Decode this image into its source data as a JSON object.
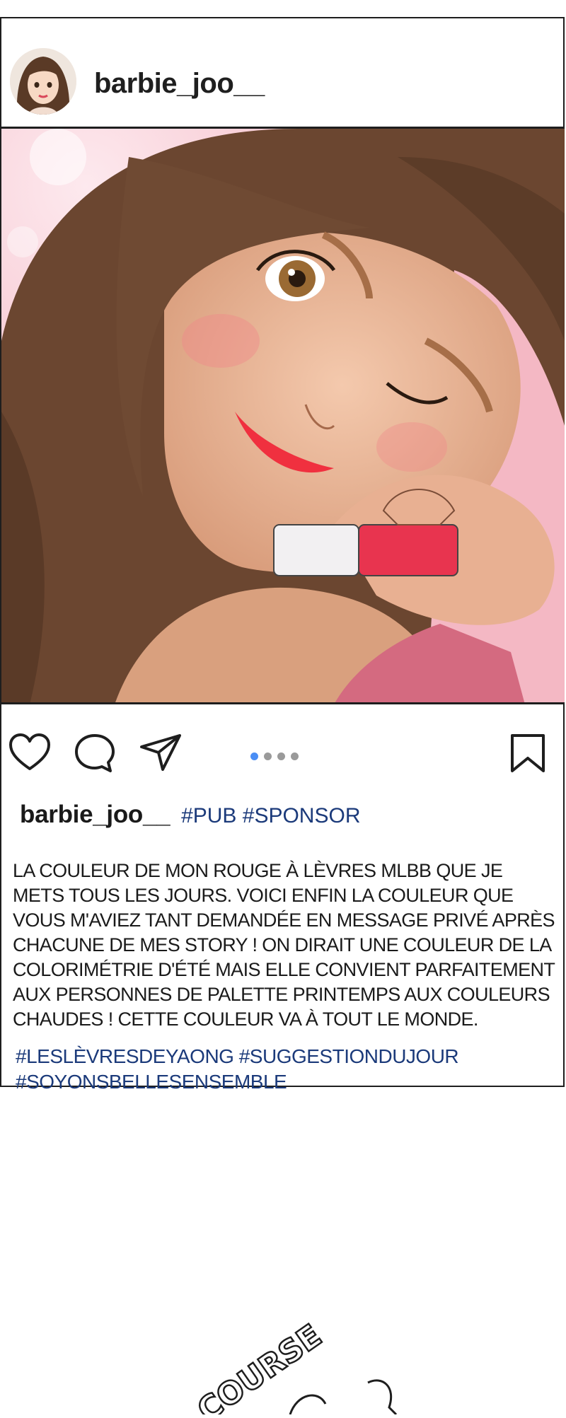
{
  "post": {
    "username": "barbie_joo__",
    "caption_tags": "#PUB #SPONSOR",
    "caption": "LA COULEUR DE MON ROUGE À LÈVRES MLBB QUE JE METS TOUS LES JOURS. VOICI ENFIN LA COULEUR QUE VOUS M'AVIEZ TANT DEMANDÉE EN MESSAGE PRIVÉ APRÈS CHACUNE DE MES STORY ! ON DIRAIT UNE COULEUR DE LA COLORIMÉTRIE D'ÉTÉ MAIS ELLE CONVIENT PARFAITEMENT AUX PERSONNES DE PALETTE PRINTEMPS AUX COULEURS CHAUDES ! CETTE COULEUR VA À TOUT LE MONDE.",
    "hashtags": "#LESLÈVRESDEYAONG #SUGGESTIONDUJOUR #SOYONSBELLESENSEMBLE",
    "carousel": {
      "count": 4,
      "active_index": 0
    }
  },
  "icons": {
    "like": "heart-icon",
    "comment": "comment-icon",
    "share": "send-icon",
    "save": "bookmark-icon"
  },
  "colors": {
    "border": "#1e1e1e",
    "hashtag": "#1b3a7a",
    "active_dot": "#4a8ef5",
    "lipstick": "#e8344f"
  },
  "sfx_text": "COURSE"
}
